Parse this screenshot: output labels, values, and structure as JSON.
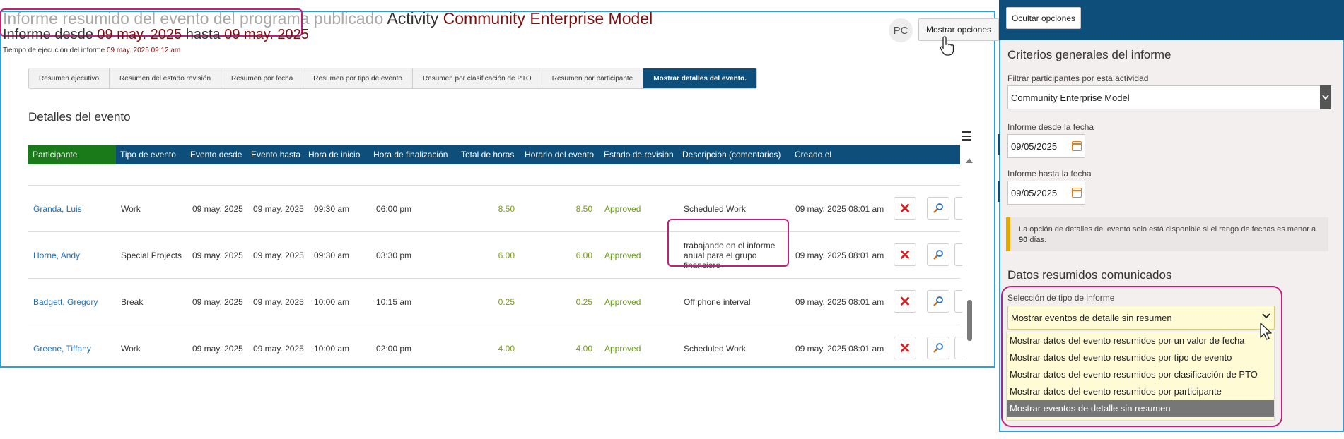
{
  "report": {
    "title_part1": "Informe resumido del evento del programa publicado",
    "title_part2": "Activity",
    "title_part3": "Community Enterprise Model",
    "subtitle_prefix": "Informe desde",
    "subtitle_from": "09 may. 2025",
    "subtitle_mid": "hasta",
    "subtitle_to": "09 may. 2025",
    "runtime_label": "Tiempo de ejecución del informe",
    "runtime_value": "09 may. 2025 09:12 am",
    "avatar": "PC",
    "show_options": "Mostrar opciones"
  },
  "tabs": [
    {
      "label": "Resumen ejecutivo"
    },
    {
      "label": "Resumen del estado revisión"
    },
    {
      "label": "Resumen por fecha"
    },
    {
      "label": "Resumen por tipo de evento"
    },
    {
      "label": "Resumen por clasificación de PTO"
    },
    {
      "label": "Resumen por participante"
    },
    {
      "label": "Mostrar detalles del evento."
    }
  ],
  "section_title": "Detalles del evento",
  "table": {
    "headers": [
      "Participante",
      "Tipo de evento",
      "Evento desde",
      "Evento hasta",
      "Hora de inicio",
      "Hora de finalización",
      "Total de horas",
      "Horario del evento",
      "Estado de revisión",
      "Descripción (comentarios)",
      "Creado el"
    ],
    "rows": [
      {
        "participant": "Granda, Luis",
        "type": "Work",
        "from": "09 may. 2025",
        "to": "09 may. 2025",
        "start": "09:30 am",
        "end": "06:00 pm",
        "total": "8.50",
        "schedule": "8.50",
        "status": "Approved",
        "desc": "Scheduled Work",
        "created": "09 may. 2025 08:01 am"
      },
      {
        "participant": "Horne, Andy",
        "type": "Special Projects",
        "from": "09 may. 2025",
        "to": "09 may. 2025",
        "start": "09:30 am",
        "end": "03:30 pm",
        "total": "6.00",
        "schedule": "6.00",
        "status": "Approved",
        "desc": "trabajando en el informe anual para el grupo financiero",
        "created": "09 may. 2025 08:01 am"
      },
      {
        "participant": "Badgett, Gregory",
        "type": "Break",
        "from": "09 may. 2025",
        "to": "09 may. 2025",
        "start": "10:00 am",
        "end": "10:15 am",
        "total": "0.25",
        "schedule": "0.25",
        "status": "Approved",
        "desc": "Off phone interval",
        "created": "09 may. 2025 08:01 am"
      },
      {
        "participant": "Greene, Tiffany",
        "type": "Work",
        "from": "09 may. 2025",
        "to": "09 may. 2025",
        "start": "10:00 am",
        "end": "02:00 pm",
        "total": "4.00",
        "schedule": "4.00",
        "status": "Approved",
        "desc": "Scheduled Work",
        "created": "09 may. 2025 08:01 am"
      }
    ]
  },
  "panel": {
    "hide_options": "Ocultar opciones",
    "general_title": "Criterios generales del informe",
    "filter_label": "Filtrar participantes por esta actividad",
    "filter_value": "Community Enterprise Model",
    "from_label": "Informe desde la fecha",
    "from_value": "09/05/2025",
    "to_label": "Informe hasta la fecha",
    "to_value": "09/05/2025",
    "notice_text": "La opción de detalles del evento solo está disponible si el rango de fechas es menor a",
    "notice_bold": "90",
    "notice_suffix": "días.",
    "summary_title": "Datos resumidos comunicados",
    "type_label": "Selección de tipo de informe",
    "type_value": "Mostrar eventos de detalle sin resumen",
    "type_options": [
      "Mostrar datos del evento resumidos por un valor de fecha",
      "Mostrar datos del evento resumidos por tipo de evento",
      "Mostrar datos del evento resumidos por clasificación de PTO",
      "Mostrar datos del evento resumidos por participante",
      "Mostrar eventos de detalle sin resumen"
    ]
  },
  "colors": {
    "accent": "#0d4f7a",
    "border": "#2aa0d8",
    "highlight": "#c0207a",
    "approved": "#6a9a1a",
    "delete": "#d42020"
  }
}
